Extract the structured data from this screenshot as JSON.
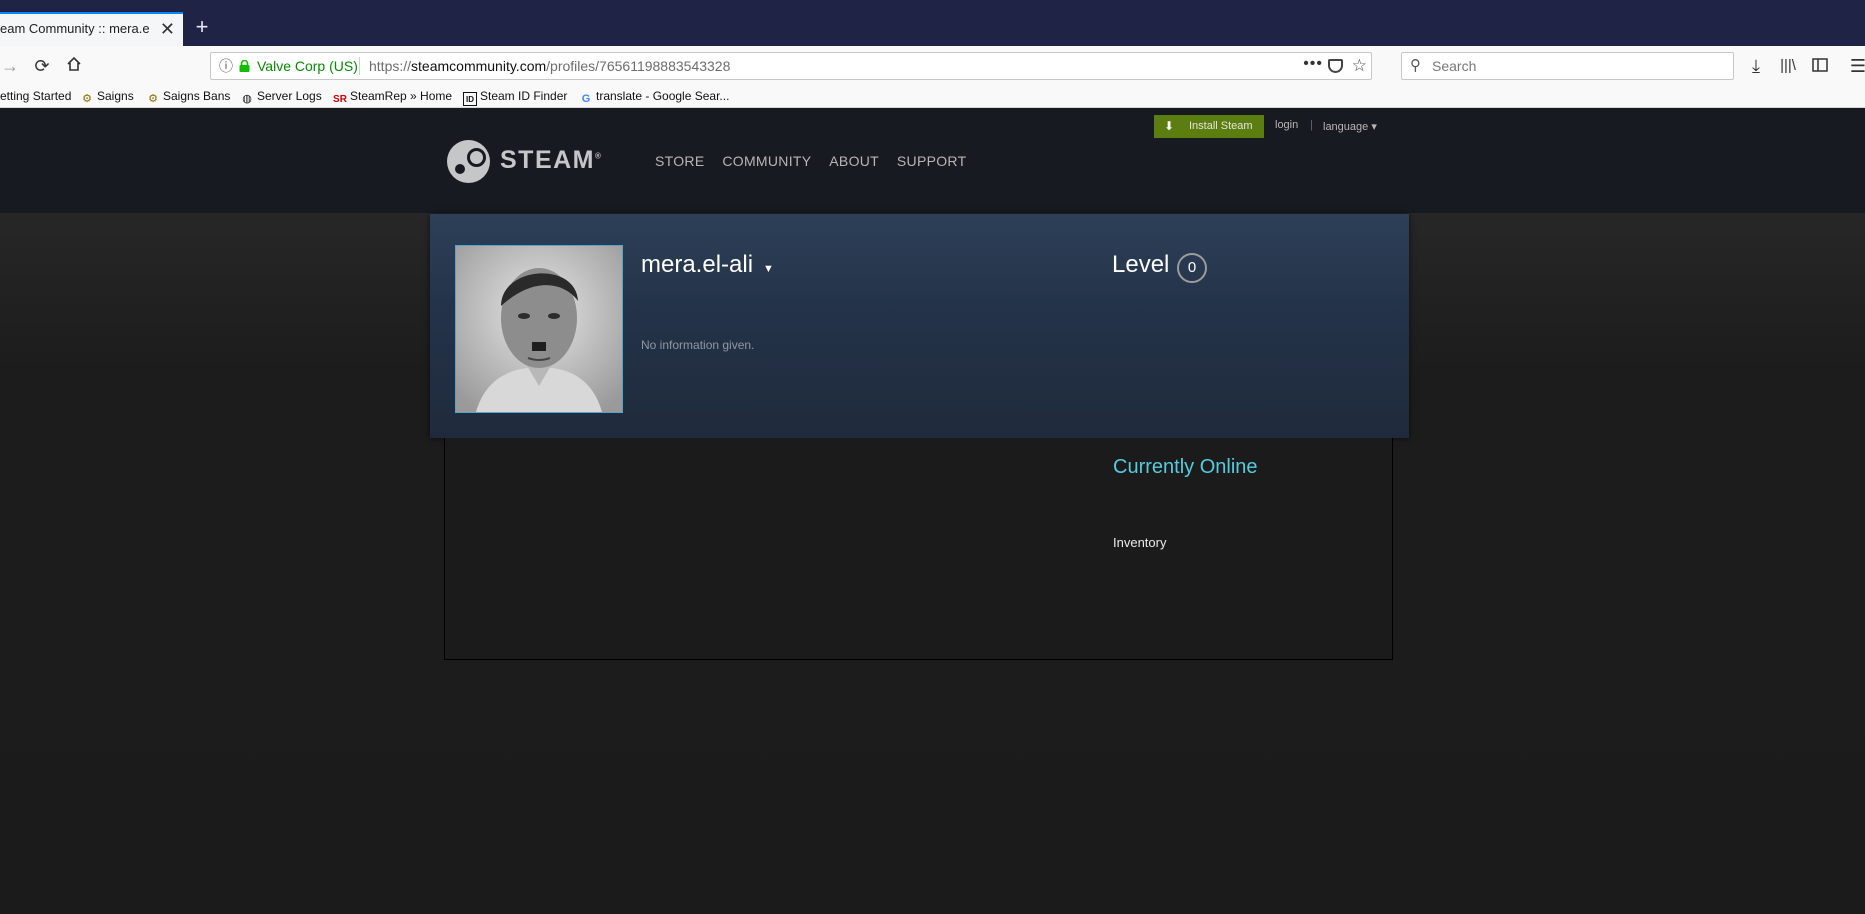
{
  "browser": {
    "tab_title": "eam Community :: mera.el-al",
    "tab_close": "✕",
    "new_tab": "+",
    "url_identity": "Valve Corp (US)",
    "url_prefix": "https://",
    "url_domain": "steamcommunity.com",
    "url_path": "/profiles/76561198883543328",
    "search_placeholder": "Search",
    "bookmarks": [
      {
        "label": "etting Started",
        "icon": "none"
      },
      {
        "label": "Saigns",
        "icon": "gear-icon"
      },
      {
        "label": "Saigns Bans",
        "icon": "gear-icon"
      },
      {
        "label": "Server Logs",
        "icon": "globe-icon"
      },
      {
        "label": "SteamRep » Home",
        "icon": "sr-icon",
        "icon_text": "SR"
      },
      {
        "label": "Steam ID Finder",
        "icon": "id-icon",
        "icon_text": "ID"
      },
      {
        "label": "translate - Google Sear...",
        "icon": "google-icon",
        "icon_text": "G"
      }
    ]
  },
  "steam": {
    "logo_text": "STEAM",
    "logo_reg": "®",
    "nav": [
      "STORE",
      "COMMUNITY",
      "ABOUT",
      "SUPPORT"
    ],
    "install_label": "Install Steam",
    "login_label": "login",
    "separator": "|",
    "language_label": "language ▾"
  },
  "profile": {
    "persona_name": "mera.el-ali",
    "persona_arrow": "▼",
    "summary": "No information given.",
    "level_label": "Level",
    "level_value": "0",
    "status": "Currently Online",
    "inventory_label": "Inventory"
  },
  "colors": {
    "steam_header": "#171a21",
    "install_green": "#5c7e10",
    "online_blue": "#57cbde",
    "avatar_border": "#57a6c9"
  }
}
